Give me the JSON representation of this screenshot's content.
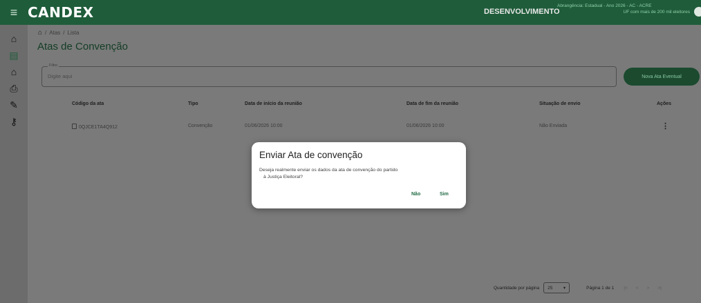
{
  "app": {
    "logo": "CANDEX"
  },
  "header": {
    "environment": "DESENVOLVIMENTO",
    "scope_line1": "Abrangência: Estadual - Ano 2026 - AC - ACRE",
    "scope_line2": "UF com mais de 200 mil eleitores"
  },
  "sidebar": {
    "items": [
      {
        "icon": "home-icon",
        "glyph": "⌂"
      },
      {
        "icon": "document-icon",
        "glyph": "▤"
      },
      {
        "icon": "institution-icon",
        "glyph": "⌂"
      },
      {
        "icon": "printer-icon",
        "glyph": "⎙"
      },
      {
        "icon": "tools-icon",
        "glyph": "✎"
      },
      {
        "icon": "key-icon",
        "glyph": "⚷"
      }
    ]
  },
  "breadcrumb": {
    "home_glyph": "⌂",
    "sep": "/",
    "item1": "Atas",
    "item2": "Lista"
  },
  "page": {
    "title": "Atas de Convenção"
  },
  "filter": {
    "legend": "Filtro",
    "placeholder": "Digite aqui"
  },
  "new_button": {
    "label": "Nova Ata Eventual"
  },
  "table": {
    "headers": [
      "Código da ata",
      "Tipo",
      "Data de início da reunião",
      "Data de fim da reunião",
      "Situação de envio",
      "Ações"
    ],
    "rows": [
      {
        "code": "0QJCE1TA4Q912",
        "type": "Convenção",
        "start": "01/06/2026 10:00",
        "end": "01/06/2026 10:00",
        "status": "Não Enviada",
        "actions": "⋮"
      }
    ]
  },
  "pagination": {
    "per_page_label": "Quantidade por página",
    "per_page_value": "25",
    "dropdown_glyph": "▾",
    "page_info": "Página 1 de 1",
    "first": "|<",
    "prev": "<",
    "next": ">",
    "last": ">|"
  },
  "modal": {
    "title": "Enviar Ata de convenção",
    "body_line1": "Deseja realmente enviar os dados da ata de convenção do partido",
    "body_line2": "à Justiça Eleitoral?",
    "no_label": "Não",
    "yes_label": "Sim"
  },
  "colors": {
    "brand": "#1f5c3a",
    "accent": "#1f6a43",
    "overlay": "#7a7a7a"
  }
}
